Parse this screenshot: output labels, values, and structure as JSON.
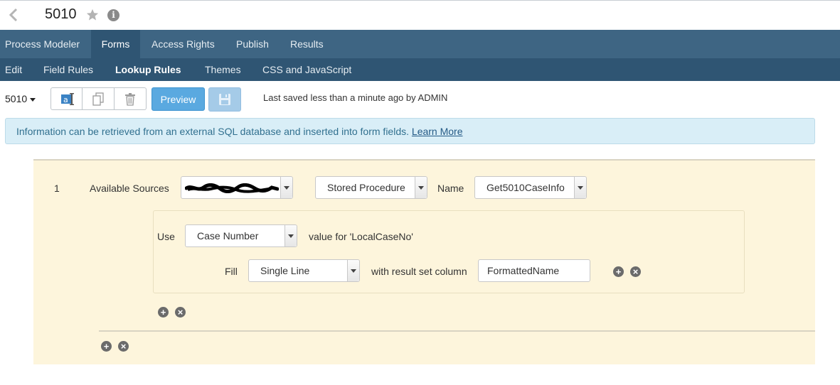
{
  "header": {
    "title": "5010"
  },
  "nav_primary": [
    "Process Modeler",
    "Forms",
    "Access Rights",
    "Publish",
    "Results"
  ],
  "nav_secondary": [
    "Edit",
    "Field Rules",
    "Lookup Rules",
    "Themes",
    "CSS and JavaScript"
  ],
  "toolbar": {
    "form_selector": "5010",
    "preview_label": "Preview",
    "last_saved": "Last saved less than a minute ago by ADMIN"
  },
  "info": {
    "text": "Information can be retrieved from an external SQL database and inserted into form fields.",
    "link": "Learn More"
  },
  "rule": {
    "number": "1",
    "available_sources_label": "Available Sources",
    "source_type": "Stored Procedure",
    "name_label": "Name",
    "name_value": "Get5010CaseInfo",
    "use_label": "Use",
    "use_value": "Case Number",
    "value_for_text": "value for 'LocalCaseNo'",
    "fill_label": "Fill",
    "fill_value": "Single Line",
    "result_label": "with result set column",
    "result_value": "FormattedName"
  },
  "colors": {
    "nav_primary": "#3e6583",
    "nav_secondary": "#2f5573",
    "preview": "#5aa9e0",
    "panel": "#fdf5dc"
  }
}
